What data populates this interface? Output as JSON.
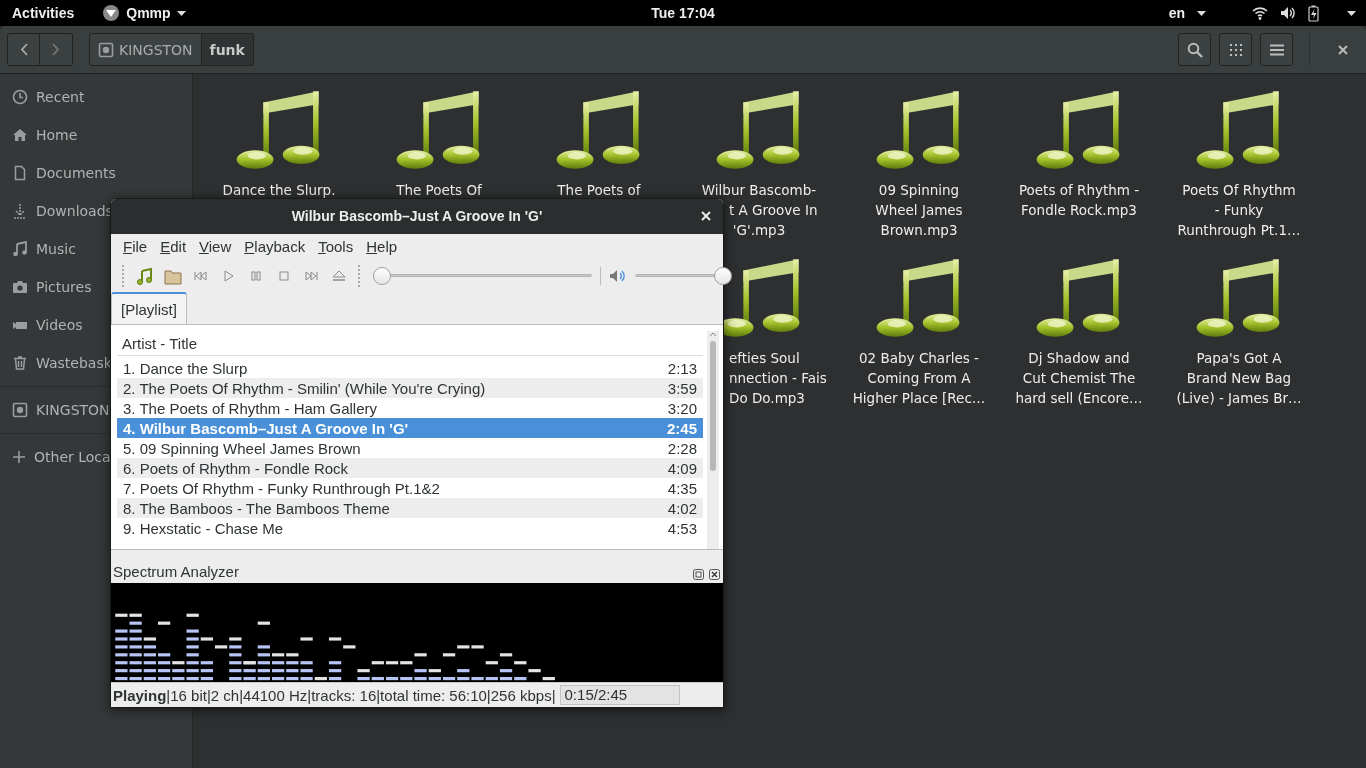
{
  "top_bar": {
    "activities": "Activities",
    "app_menu": "Qmmp",
    "clock": "Tue 17:04",
    "language": "en"
  },
  "files": {
    "path": [
      {
        "label": "KINGSTON",
        "selected": false
      },
      {
        "label": "funk",
        "selected": true
      }
    ],
    "sidebar": {
      "sections": [
        [
          "Recent",
          "Home",
          "Documents",
          "Downloads",
          "Music",
          "Pictures",
          "Videos",
          "Wastebask"
        ],
        [
          "KINGSTON"
        ],
        [
          "Other Loca"
        ]
      ]
    },
    "rows": [
      [
        {
          "label": [
            "Dance the Slurp."
          ]
        },
        {
          "label": [
            "The Poets Of"
          ]
        },
        {
          "label": [
            "The Poets of"
          ]
        },
        {
          "label": [
            {
              "text": "Wilbur Bascomb-",
              "cut_left": false
            },
            {
              "text": "t A Groove In",
              "cut_left": true
            },
            {
              "text": "'G'.mp3",
              "cut_left": false
            }
          ]
        },
        {
          "label": [
            "09 Spinning",
            "Wheel James",
            "Brown.mp3"
          ]
        },
        {
          "label": [
            "Poets of Rhythm -",
            "Fondle Rock.mp3"
          ]
        },
        {
          "label": [
            "Poets Of Rhythm",
            "- Funky",
            "Runthrough Pt.1…"
          ]
        }
      ],
      [
        "",
        "",
        "",
        {
          "label": [
            {
              "text": "efties Soul",
              "cut_left": true
            },
            {
              "text": "nnection - Fais",
              "cut_left": true
            },
            {
              "text": "Do Do.mp3",
              "cut_left": true
            }
          ]
        },
        {
          "label": [
            "02 Baby Charles -",
            "Coming From A",
            "Higher Place [Rec…"
          ]
        },
        {
          "label": [
            "Dj Shadow and",
            "Cut Chemist The",
            "hard sell (Encore…"
          ]
        },
        {
          "label": [
            "Papa's Got A",
            "Brand New Bag",
            "(Live) - James Br…"
          ]
        }
      ]
    ]
  },
  "player": {
    "title": "Wilbur Bascomb–Just A Groove In 'G'",
    "menus": [
      "File",
      "Edit",
      "View",
      "Playback",
      "Tools",
      "Help"
    ],
    "seek": {
      "level": 0.04
    },
    "volume": {
      "level": 1.0
    },
    "tab": "[Playlist]",
    "column": "Artist - Title",
    "tracks": [
      {
        "title": "1. Dance the Slurp",
        "time": "2:13",
        "selected": false
      },
      {
        "title": "2. The Poets Of Rhythm - Smilin' (While You're Crying)",
        "time": "3:59",
        "selected": false
      },
      {
        "title": "3. The Poets of Rhythm - Ham Gallery",
        "time": "3:20",
        "selected": false
      },
      {
        "title": "4. Wilbur Bascomb–Just A Groove In 'G'",
        "time": "2:45",
        "selected": true
      },
      {
        "title": "5. 09 Spinning Wheel James Brown",
        "time": "2:28",
        "selected": false
      },
      {
        "title": "6. Poets of Rhythm - Fondle Rock",
        "time": "4:09",
        "selected": false
      },
      {
        "title": "7. Poets Of Rhythm - Funky Runthrough Pt.1&2",
        "time": "4:35",
        "selected": false
      },
      {
        "title": "8. The Bamboos - The Bamboos Theme",
        "time": "4:02",
        "selected": false
      },
      {
        "title": "9. Hexstatic - Chase Me",
        "time": "4:53",
        "selected": false
      }
    ],
    "spectrum_title": "Spectrum Analyzer",
    "status": "**Playing**|16 bit|2 ch|44100 Hz|tracks: 16|total time: 56:10|256 kbps|",
    "position": "0:15/2:45"
  }
}
